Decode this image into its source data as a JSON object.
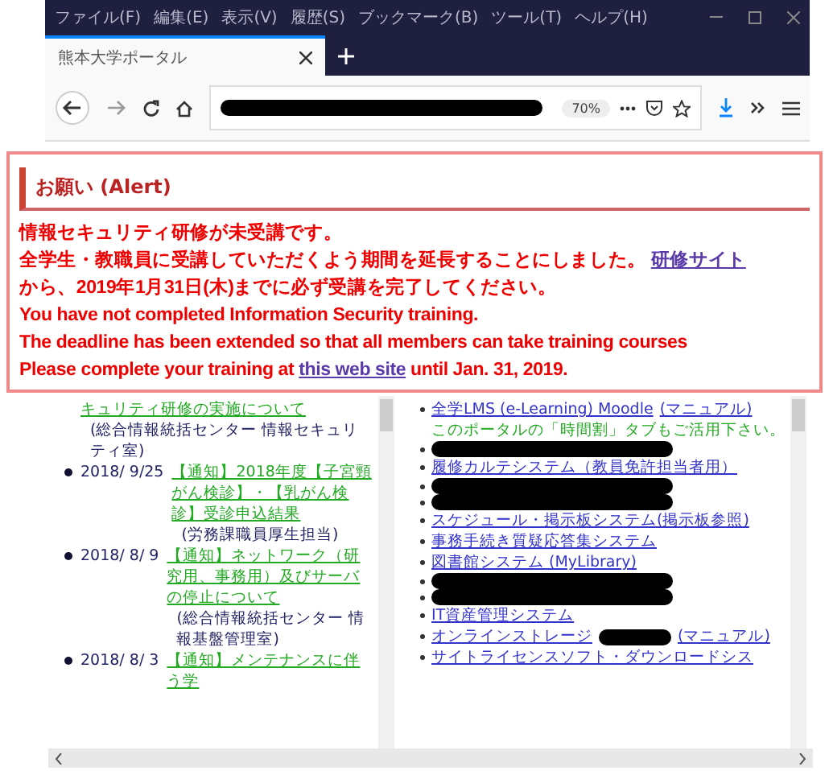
{
  "menu": [
    "ファイル(F)",
    "編集(E)",
    "表示(V)",
    "履歴(S)",
    "ブックマーク(B)",
    "ツール(T)",
    "ヘルプ(H)"
  ],
  "tab": {
    "title": "熊本大学ポータル",
    "selected": true
  },
  "toolbar": {
    "zoom": "70%"
  },
  "alert": {
    "title": "お願い (Alert)",
    "lines": [
      [
        {
          "text": "情報セキュリティ研修が未受講です。",
          "link": false
        }
      ],
      [
        {
          "text": "全学生・教職員に受講していただくよう期間を延長することにしました。 ",
          "link": false
        },
        {
          "text": "研修サイト",
          "link": true
        }
      ],
      [
        {
          "text": "から、2019年1月31日(木)までに必ず受講を完了してください。",
          "link": false
        }
      ],
      [
        {
          "text": "You have not completed Information Security training.",
          "link": false
        }
      ],
      [
        {
          "text": "The deadline has been extended so that all members can take training courses",
          "link": false
        }
      ],
      [
        {
          "text": "Please complete your training at ",
          "link": false
        },
        {
          "text": "this web site",
          "link": true
        },
        {
          "text": " until Jan. 31, 2019.",
          "link": false
        }
      ]
    ]
  },
  "news": [
    {
      "title": "キュリティ研修の実施について",
      "dept": "(総合情報統括センター 情報セキュリティ室)"
    },
    {
      "date": "2018/ 9/25",
      "title": "【通知】2018年度【子宮頸がん検診】・【乳がん検診】受診申込結果",
      "dept": "(労務課職員厚生担当)"
    },
    {
      "date": "2018/ 8/ 9",
      "title": "【通知】ネットワーク（研究用、事務用）及びサーバの停止について",
      "dept": "(総合情報統括センター 情報基盤管理室)"
    },
    {
      "date": "2018/ 8/ 3",
      "title": "【通知】メンテナンスに伴う学"
    }
  ],
  "links": [
    {
      "kind": "link",
      "text": "全学LMS (e-Learning) Moodle",
      "manual": "(マニュアル)"
    },
    {
      "kind": "note",
      "text": "このポータルの「時間割」タブもご活用下さい。"
    },
    {
      "kind": "redacted"
    },
    {
      "kind": "link",
      "text": "履修カルテシステム（教員免許担当者用）"
    },
    {
      "kind": "redacted"
    },
    {
      "kind": "redacted"
    },
    {
      "kind": "link",
      "text": "スケジュール・掲示板システム(掲示板参照)"
    },
    {
      "kind": "link",
      "text": "事務手続き質疑応答集システム"
    },
    {
      "kind": "link",
      "text": "図書館システム (MyLibrary)"
    },
    {
      "kind": "redacted"
    },
    {
      "kind": "redacted"
    },
    {
      "kind": "link",
      "text": "IT資産管理システム"
    },
    {
      "kind": "link",
      "text": "オンラインストレージ",
      "manual": "(マニュアル)",
      "redacted": true
    },
    {
      "kind": "link",
      "text": "サイトライセンスソフト・ダウンロードシス"
    }
  ]
}
